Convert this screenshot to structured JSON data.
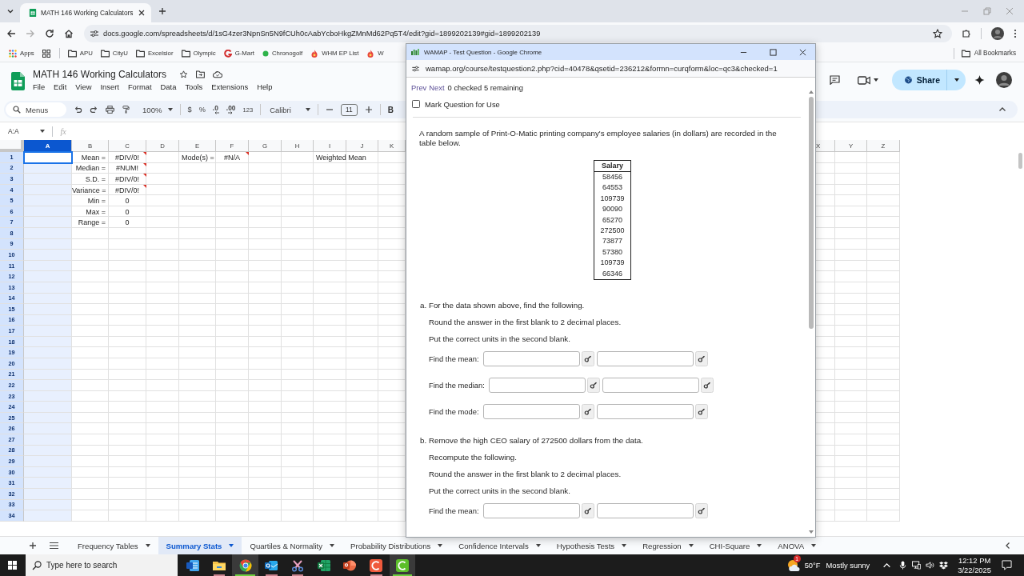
{
  "browser": {
    "tabs": [
      {
        "title": "MATH 146 Working Calculators",
        "selected": true
      }
    ],
    "nav": {
      "back_disabled": false,
      "forward_disabled": true
    },
    "url": "docs.google.com/spreadsheets/d/1sG4zer3NpnSn5N9fCUh0cAabYcboHkgZMnMd62Pq5T4/edit?gid=1899202139#gid=1899202139",
    "bookmarks": [
      {
        "kind": "apps",
        "label": "Apps"
      },
      {
        "kind": "grid"
      },
      {
        "kind": "folder",
        "label": "APU"
      },
      {
        "kind": "folder",
        "label": "CityU"
      },
      {
        "kind": "folder",
        "label": "Excelsior"
      },
      {
        "kind": "folder",
        "label": "Olympic"
      },
      {
        "kind": "swirl",
        "label": "G-Mart"
      },
      {
        "kind": "dot",
        "label": "Chronogolf"
      },
      {
        "kind": "flame",
        "label": "WHM EP List"
      },
      {
        "kind": "flame",
        "label": "W"
      }
    ],
    "all_bookmarks": "All Bookmarks"
  },
  "sheets": {
    "title": "MATH 146 Working Calculators",
    "menu": [
      "File",
      "Edit",
      "View",
      "Insert",
      "Format",
      "Data",
      "Tools",
      "Extensions",
      "Help"
    ],
    "share": "Share",
    "toolbar": {
      "search": "Menus",
      "zoom": "100%",
      "currency": "$",
      "percent": "%",
      "decrease_decimals": ".0",
      "increase_decimals": ".00",
      "number_format": "123",
      "font": "Calibri",
      "font_size": "11",
      "bold": "B"
    },
    "name_box": "A:A",
    "formula_label": "fx",
    "columns": [
      {
        "label": "A",
        "selected": true,
        "cells": [
          {
            "kind": "blank",
            "error": false,
            "active": true
          }
        ]
      },
      {
        "label": "B",
        "selected": false,
        "cells": [
          {
            "kind": "label",
            "text": "Mean =",
            "error": false,
            "active": false
          },
          {
            "kind": "label",
            "text": "Median =",
            "error": false,
            "active": false
          },
          {
            "kind": "label",
            "text": "S.D. =",
            "error": false,
            "active": false
          },
          {
            "kind": "label",
            "text": "Variance =",
            "error": false,
            "active": false
          },
          {
            "kind": "label",
            "text": "Min =",
            "error": false,
            "active": false
          },
          {
            "kind": "label",
            "text": "Max =",
            "error": false,
            "active": false
          },
          {
            "kind": "label",
            "text": "Range =",
            "error": false,
            "active": false
          }
        ]
      },
      {
        "label": "C",
        "selected": false,
        "cells": [
          {
            "kind": "result",
            "text": "#DIV/0!",
            "error": true,
            "active": false
          },
          {
            "kind": "result",
            "text": "#NUM!",
            "error": true,
            "active": false
          },
          {
            "kind": "result",
            "text": "#DIV/0!",
            "error": true,
            "active": false
          },
          {
            "kind": "result",
            "text": "#DIV/0!",
            "error": true,
            "active": false
          },
          {
            "kind": "result",
            "text": "0",
            "error": false,
            "active": false
          },
          {
            "kind": "result",
            "text": "0",
            "error": false,
            "active": false
          },
          {
            "kind": "result",
            "text": "0",
            "error": false,
            "active": false
          }
        ]
      },
      {
        "label": "D",
        "selected": false
      },
      {
        "label": "E",
        "selected": false,
        "cells": [
          {
            "kind": "text",
            "text": "Mode(s) =",
            "error": false,
            "active": false
          }
        ]
      },
      {
        "label": "F",
        "selected": false,
        "cells": [
          {
            "kind": "result",
            "text": "#N/A",
            "error": true,
            "active": false
          }
        ]
      },
      {
        "label": "G",
        "selected": false
      },
      {
        "label": "H",
        "selected": false
      },
      {
        "label": "I",
        "selected": false,
        "cells": [
          {
            "kind": "text",
            "text": "Weighted Mean",
            "error": false,
            "active": false
          }
        ]
      },
      {
        "label": "J",
        "selected": false
      },
      {
        "label": "K",
        "selected": false
      }
    ],
    "right_columns": [
      {
        "label": "X",
        "selected": false
      },
      {
        "label": "Y",
        "selected": false
      },
      {
        "label": "Z",
        "selected": false
      }
    ],
    "row_numbers": [
      "1",
      "2",
      "3",
      "4",
      "5",
      "6",
      "7",
      "8",
      "9",
      "10",
      "11",
      "12",
      "13",
      "14",
      "15",
      "16",
      "17",
      "18",
      "19",
      "20",
      "21",
      "22",
      "23",
      "24",
      "25",
      "26",
      "27",
      "28",
      "29",
      "30",
      "31",
      "32",
      "33",
      "34"
    ],
    "sheet_tabs": [
      {
        "label": "Frequency Tables",
        "selected": false
      },
      {
        "label": "Summary Stats",
        "selected": true
      },
      {
        "label": "Quartiles & Normality",
        "selected": false
      },
      {
        "label": "Probability Distributions",
        "selected": false
      },
      {
        "label": "Confidence Intervals",
        "selected": false
      },
      {
        "label": "Hypothesis Tests",
        "selected": false
      },
      {
        "label": "Regression",
        "selected": false
      },
      {
        "label": "CHI-Square",
        "selected": false
      },
      {
        "label": "ANOVA",
        "selected": false
      }
    ]
  },
  "popup": {
    "title": "WAMAP - Test Question - Google Chrome",
    "url": "wamap.org/course/testquestion2.php?cid=40478&qsetid=236212&formn=curqform&loc=qc3&checked=1",
    "nav_links": [
      "Prev",
      "Next"
    ],
    "status": "0 checked 5 remaining",
    "mark_checkbox": {
      "label": "Mark Question for Use",
      "checked": false
    },
    "question": "A random sample of Print-O-Matic printing company's employee salaries (in dollars) are recorded in the table below.",
    "table": {
      "header": "Salary",
      "rows": [
        "58456",
        "64553",
        "109739",
        "90090",
        "65270",
        "272500",
        "73877",
        "57380",
        "109739",
        "66346"
      ]
    },
    "parts": [
      {
        "heading": "a. For the data shown above, find the following.",
        "instructions": [
          "Round the answer in the first blank to 2 decimal places.",
          "Put the correct units in the second blank."
        ],
        "answers": [
          "Find the mean:",
          "Find the median:",
          "Find the mode:"
        ]
      },
      {
        "heading": "b. Remove the high CEO salary of 272500 dollars from the data.",
        "instructions": [
          "Recompute the following.",
          "Round the answer in the first blank to 2 decimal places.",
          "Put the correct units in the second blank."
        ],
        "answers": [
          "Find the mean:"
        ]
      }
    ]
  },
  "taskbar": {
    "search_placeholder": "Type here to search",
    "apps": [
      {
        "kind": "word",
        "open": false,
        "selected": false
      },
      {
        "kind": "explorer",
        "open": true,
        "selected": false
      },
      {
        "kind": "chrome",
        "open": true,
        "selected": true
      },
      {
        "kind": "outlook",
        "open": true,
        "selected": false
      },
      {
        "kind": "snip",
        "open": true,
        "selected": false
      },
      {
        "kind": "excel",
        "open": false,
        "selected": false
      },
      {
        "kind": "powerpoint",
        "open": false,
        "selected": false
      },
      {
        "kind": "camtasia",
        "open": true,
        "selected": false
      },
      {
        "kind": "recorder",
        "open": true,
        "selected": true
      }
    ],
    "weather": {
      "badge": "1",
      "temperature": "50°F",
      "condition": "Mostly sunny"
    },
    "time": "12:12 PM",
    "date": "3/22/2025"
  }
}
